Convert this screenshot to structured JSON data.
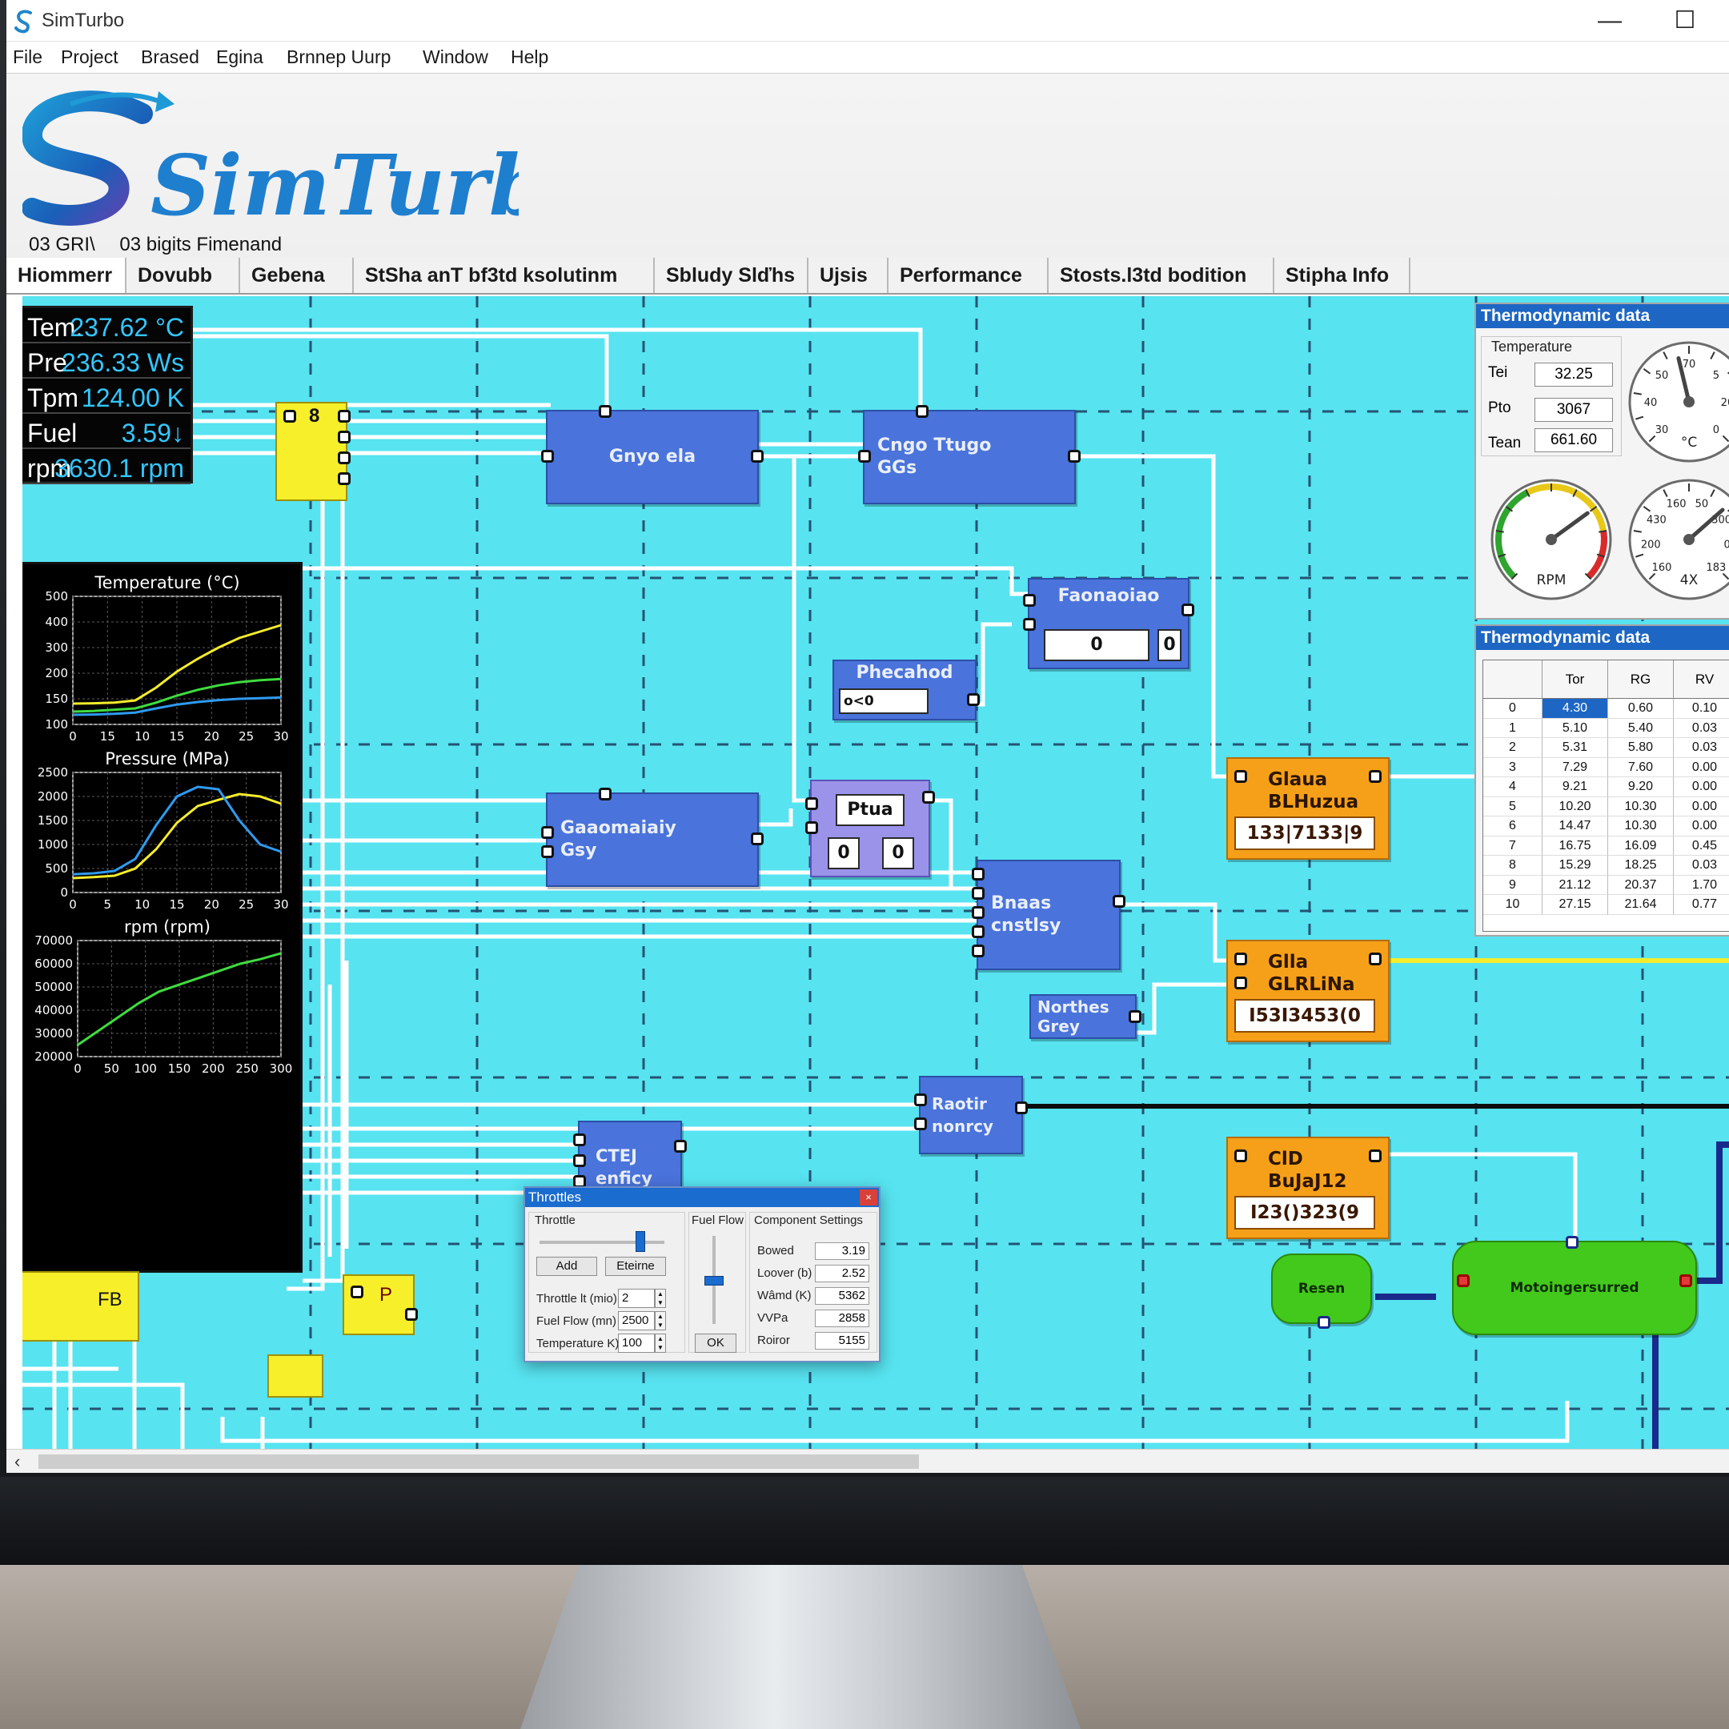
{
  "window": {
    "title": "SimTurbo",
    "minimize_glyph": "—",
    "maximize_glyph": "☐"
  },
  "menu": [
    "File",
    "Project",
    "Brased",
    "Egina",
    "Brnnep Uurp",
    "Window",
    "Help"
  ],
  "logo": {
    "text": "SimTurbo"
  },
  "subtitle": [
    "03 GRI\\",
    "03 bigits Fimenand"
  ],
  "tabs": [
    "Hiommerr",
    "Dovubb",
    "Gebena",
    "StSha anT bf3td ksolutinm",
    "Sbludy Slďhs",
    "Ujsis",
    "Performance",
    "Stosts.l3td bodition",
    "Stipha Info"
  ],
  "readout": [
    {
      "key": "Tem.",
      "value": "237.62 °C"
    },
    {
      "key": "Pre",
      "value": "236.33 Ws"
    },
    {
      "key": "Tpm",
      "value": "124.00 K"
    },
    {
      "key": "Fuel",
      "value": "3.59↓"
    },
    {
      "key": "rpm",
      "value": "3630.1 rpm"
    }
  ],
  "chart_data": [
    {
      "type": "line",
      "title": "Temperature (°C)",
      "x_ticks": [
        "0",
        "15",
        "10",
        "15",
        "20",
        "25",
        "30"
      ],
      "y_ticks": [
        "100",
        "150",
        "200",
        "300",
        "400",
        "500"
      ],
      "series": [
        {
          "color": "#f5ec2b",
          "values": [
            165,
            166,
            168,
            175,
            215,
            265,
            305,
            340,
            370,
            390,
            410
          ]
        },
        {
          "color": "#3fdc3f",
          "values": [
            140,
            142,
            146,
            150,
            168,
            190,
            208,
            222,
            232,
            238,
            242
          ]
        },
        {
          "color": "#2e9bf0",
          "values": [
            130,
            131,
            133,
            137,
            150,
            162,
            170,
            176,
            180,
            182,
            184
          ]
        }
      ]
    },
    {
      "type": "line",
      "title": "Pressure (MPa)",
      "x_ticks": [
        "0",
        "5",
        "10",
        "15",
        "20",
        "25",
        "30"
      ],
      "y_ticks": [
        "0",
        "500",
        "1000",
        "1500",
        "2000",
        "2500"
      ],
      "series": [
        {
          "color": "#f5ec2b",
          "values": [
            300,
            320,
            350,
            500,
            900,
            1450,
            1800,
            1930,
            2050,
            2000,
            1850
          ]
        },
        {
          "color": "#2e9bf0",
          "values": [
            380,
            400,
            450,
            700,
            1400,
            2000,
            2200,
            2150,
            1500,
            1000,
            850
          ]
        }
      ]
    },
    {
      "type": "line",
      "title": "rpm (rpm)",
      "x_ticks": [
        "0",
        "50",
        "100",
        "150",
        "200",
        "250",
        "300"
      ],
      "y_ticks": [
        "20000",
        "30000",
        "40000",
        "50000",
        "60000",
        "70000"
      ],
      "series": [
        {
          "color": "#3fdc3f",
          "values": [
            25000,
            31000,
            37000,
            43000,
            48000,
            51000,
            54000,
            57000,
            60000,
            62000,
            64500
          ]
        }
      ]
    }
  ],
  "blocks": {
    "b1": "Gnyo ela",
    "b2": "Cngo Ttugo\nGGs",
    "b3": "Faonaoiao",
    "b3_val1": "0",
    "b3_val2": "0",
    "b4": "Phecahod",
    "b4_val": "o<0",
    "b5": "Gaaomaiaiy\nGsy",
    "b6": "Ptua",
    "b6_val1": "0",
    "b6_val2": "0",
    "b7": "Bnaas\ncnstlsy",
    "b8": "Northes\nGrey",
    "b9": "Raotir\nnonrcy",
    "b10": "CTEJ\nenficy",
    "o1": "Glaua\nBLHuzua",
    "o1_val": "133|7133|9",
    "o2": "Glla\nGLRLiNa",
    "o2_val": "I53I3453(0",
    "o3": "ClD\nBuJaJ12",
    "o3_val": "I23()323(9",
    "g1": "Resen",
    "g2": "Motoingersurred",
    "y1": "8",
    "y2": "FB",
    "y3": "P"
  },
  "thermo1": {
    "title": "Thermodynamic data",
    "group": "Temperature",
    "rows": [
      {
        "label": "Tei",
        "value": "32.25"
      },
      {
        "label": "Pto",
        "value": "3067"
      },
      {
        "label": "Tean",
        "value": "661.60"
      }
    ],
    "gauge1": {
      "unit": "°C",
      "ticks": [
        "30",
        "40",
        "50",
        "70",
        "5",
        "20",
        "0"
      ],
      "level": 0.45
    },
    "gauge2": {
      "label": "RPM",
      "level": 0.7
    },
    "gauge3": {
      "unit": "4X",
      "ticks": [
        "160",
        "200",
        "430",
        "160",
        "50",
        "300",
        "0",
        "183"
      ],
      "level": 0.68
    }
  },
  "thermo2": {
    "title": "Thermodynamic data",
    "columns": [
      "",
      "Tor",
      "RG",
      "RV"
    ],
    "rows": [
      [
        "0",
        "4.30",
        "0.60",
        "0.10"
      ],
      [
        "1",
        "5.10",
        "5.40",
        "0.03"
      ],
      [
        "2",
        "5.31",
        "5.80",
        "0.03"
      ],
      [
        "3",
        "7.29",
        "7.60",
        "0.00"
      ],
      [
        "4",
        "9.21",
        "9.20",
        "0.00"
      ],
      [
        "5",
        "10.20",
        "10.30",
        "0.00"
      ],
      [
        "6",
        "14.47",
        "10.30",
        "0.00"
      ],
      [
        "7",
        "16.75",
        "16.09",
        "0.45"
      ],
      [
        "8",
        "15.29",
        "18.25",
        "0.03"
      ],
      [
        "9",
        "21.12",
        "20.37",
        "1.70"
      ],
      [
        "10",
        "27.15",
        "21.64",
        "0.77"
      ]
    ]
  },
  "dialog": {
    "title": "Throttles",
    "close": "×",
    "throttle_group": "Throttle",
    "fuelflow_group": "Fuel Flow",
    "component_group": "Component Settings",
    "add_button": "Add",
    "eteirne_button": "Eteirne",
    "ok_button": "OK",
    "fields": [
      {
        "label": "Throttle lt (mio)",
        "value": "2"
      },
      {
        "label": "Fuel Flow (mn)",
        "value": "2500"
      },
      {
        "label": "Temperature  K)",
        "value": "100"
      }
    ],
    "settings": [
      {
        "label": "Bowed",
        "value": "3.19"
      },
      {
        "label": "Loover (b)",
        "value": "2.52"
      },
      {
        "label": "Wâmd (K)",
        "value": "5362"
      },
      {
        "label": "VVPa",
        "value": "2858"
      },
      {
        "label": "Roiror",
        "value": "5155"
      }
    ],
    "throttle_level": 0.8,
    "fuelflow_level": 0.55
  }
}
